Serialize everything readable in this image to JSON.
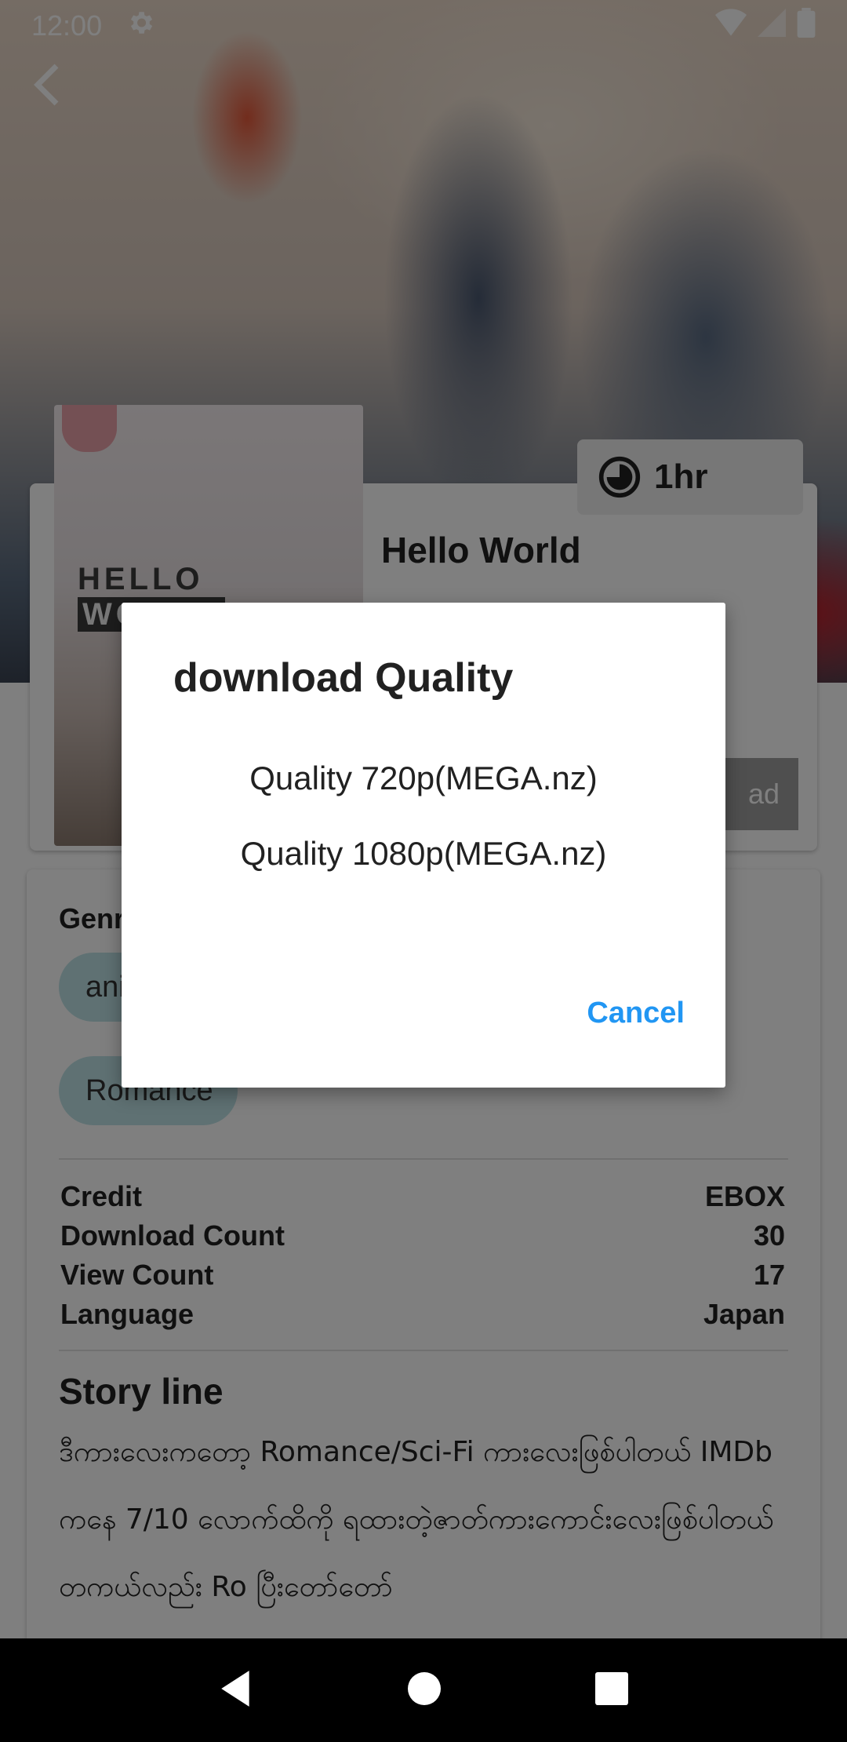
{
  "status_bar": {
    "time": "12:00"
  },
  "movie": {
    "title": "Hello World",
    "duration": "1hr",
    "poster_title_a": "HELLO",
    "poster_title_b": "WORLD",
    "download_label": "ad"
  },
  "genre": {
    "heading": "Genr",
    "chips": [
      "ani",
      "Romance"
    ]
  },
  "meta": [
    {
      "label": "Credit",
      "value": "EBOX"
    },
    {
      "label": "Download Count",
      "value": "30"
    },
    {
      "label": "View Count",
      "value": "17"
    },
    {
      "label": "Language",
      "value": "Japan"
    }
  ],
  "story": {
    "heading": "Story line",
    "text": "ဒီကားလေးကတော့ Romance/Sci-Fi ကားလေးဖြစ်ပါတယ် IMDb ကနေ 7/10 လောက်ထိကို ရထားတဲ့ဇာတ်ကားကောင်းလေးဖြစ်ပါတယ် တကယ်လည်း Ro ပြီးတော်တော်"
  },
  "dialog": {
    "title": "download Quality",
    "options": [
      "Quality 720p(MEGA.nz)",
      "Quality 1080p(MEGA.nz)"
    ],
    "cancel": "Cancel"
  },
  "colors": {
    "accent": "#2196f3",
    "chip": "#bfe3e6",
    "scrim": "rgba(0,0,0,0.5)"
  }
}
